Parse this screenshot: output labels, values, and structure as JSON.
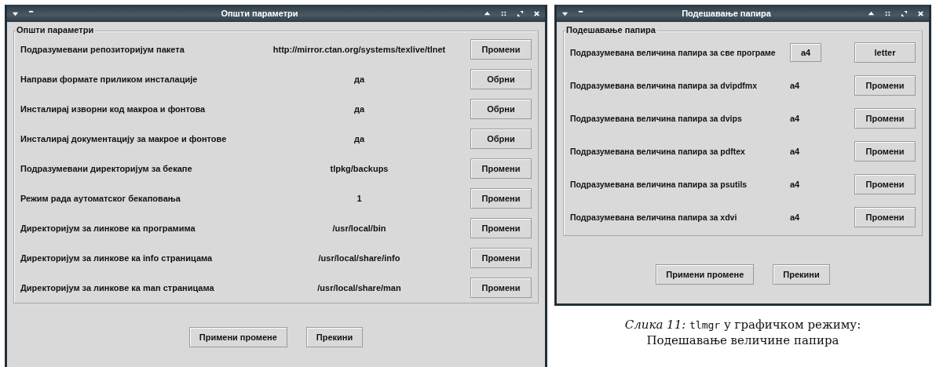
{
  "windows": [
    {
      "title": "Општи параметри",
      "group": "Општи параметри",
      "rows": [
        {
          "label": "Подразумевани репозиторијум пакета",
          "value": "http://mirror.ctan.org/systems/texlive/tlnet",
          "kind": "text",
          "button": "Промени"
        },
        {
          "label": "Направи формате приликом инсталације",
          "value": "да",
          "kind": "text",
          "button": "Обрни"
        },
        {
          "label": "Инсталирај изворни код макроа и фонтова",
          "value": "да",
          "kind": "text",
          "button": "Обрни"
        },
        {
          "label": "Инсталирај документацију за макрое и фонтове",
          "value": "да",
          "kind": "text",
          "button": "Обрни"
        },
        {
          "label": "Подразумевани директоријум за бекапе",
          "value": "tlpkg/backups",
          "kind": "text",
          "button": "Промени"
        },
        {
          "label": "Режим рада аутоматског бекаповања",
          "value": "1",
          "kind": "text",
          "button": "Промени"
        },
        {
          "label": "Директоријум за линкове ка програмима",
          "value": "/usr/local/bin",
          "kind": "text",
          "button": "Промени"
        },
        {
          "label": "Директоријум за линкове ка info страницама",
          "value": "/usr/local/share/info",
          "kind": "text",
          "button": "Промени"
        },
        {
          "label": "Директоријум за линкове ка man страницама",
          "value": "/usr/local/share/man",
          "kind": "text",
          "button": "Промени"
        }
      ],
      "buttons": [
        "Примени промене",
        "Прекини"
      ]
    },
    {
      "title": "Подешавање папира",
      "group": "Подешавање папира",
      "rows": [
        {
          "label": "Подразумевана величина папира за све програме",
          "value": "a4",
          "kind": "boxed",
          "button": "letter"
        },
        {
          "label": "Подразумевана величина папира за dvipdfmx",
          "value": "a4",
          "kind": "text",
          "button": "Промени"
        },
        {
          "label": "Подразумевана величина папира за dvips",
          "value": "a4",
          "kind": "text",
          "button": "Промени"
        },
        {
          "label": "Подразумевана величина папира за pdftex",
          "value": "a4",
          "kind": "text",
          "button": "Промени"
        },
        {
          "label": "Подразумевана величина папира за psutils",
          "value": "a4",
          "kind": "text",
          "button": "Промени"
        },
        {
          "label": "Подразумевана величина папира за xdvi",
          "value": "a4",
          "kind": "text",
          "button": "Промени"
        }
      ],
      "buttons": [
        "Примени промене",
        "Прекини"
      ]
    }
  ],
  "caption": {
    "lines": [
      [
        {
          "kind": "italic",
          "text": "Слика 11: "
        },
        {
          "kind": "code",
          "text": "tlmgr"
        },
        {
          "kind": "plain",
          "text": " у графичком режиму:"
        }
      ],
      [
        {
          "kind": "plain",
          "text": "Подешавање величине папира"
        }
      ]
    ]
  }
}
